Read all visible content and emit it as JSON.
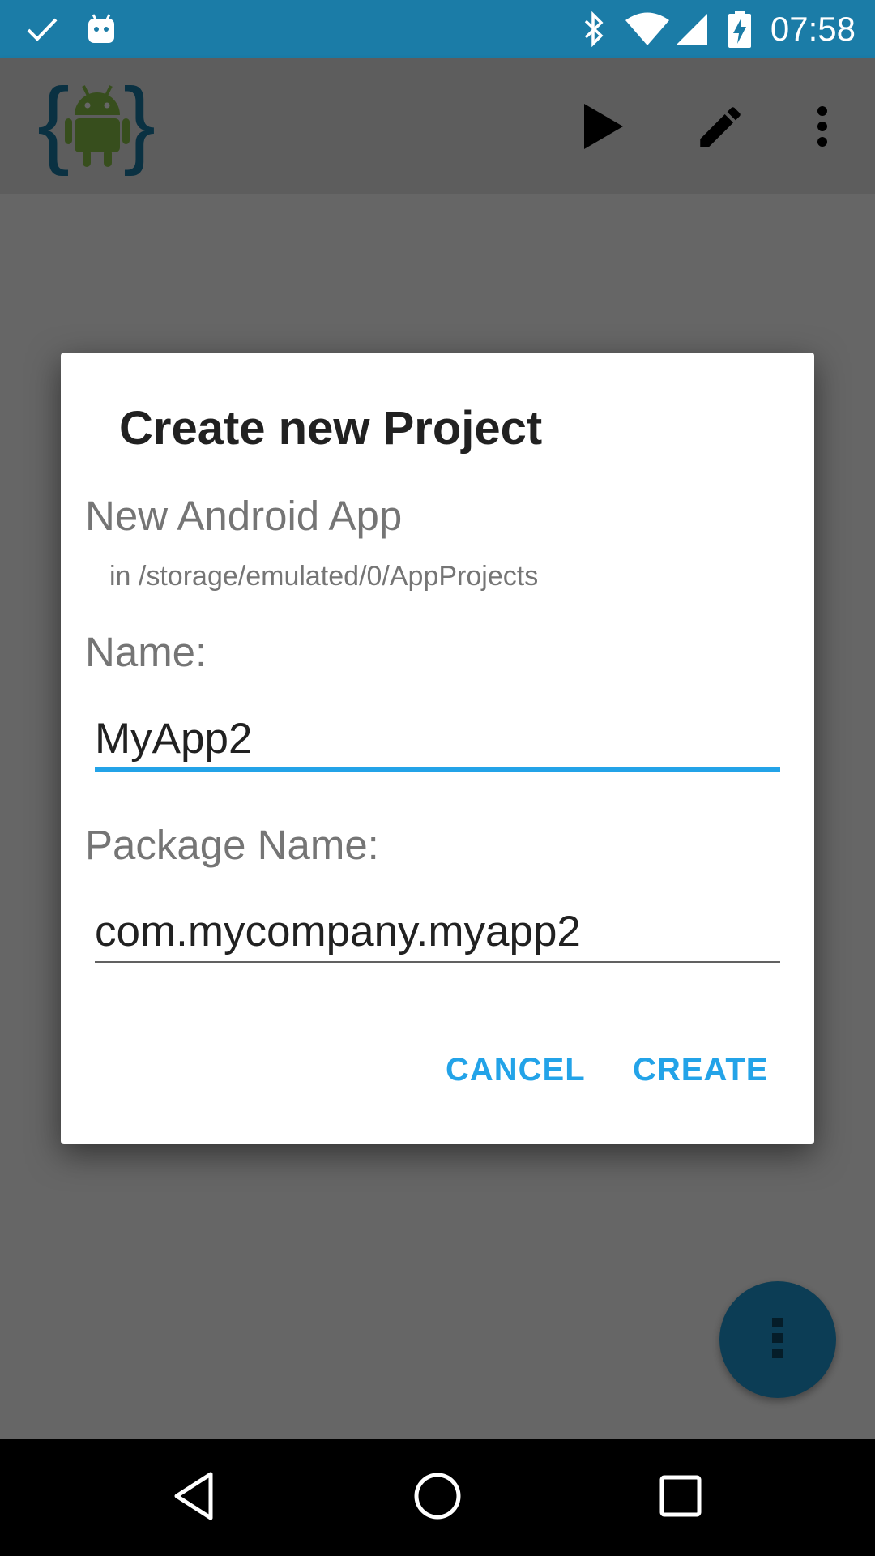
{
  "status_bar": {
    "time": "07:58",
    "icons": [
      "check-icon",
      "android-notification-icon",
      "bluetooth-icon",
      "wifi-icon",
      "cell-signal-icon",
      "battery-charging-icon"
    ],
    "color": "#1b7ca7"
  },
  "app_bar": {
    "logo": "android-ide-logo-icon",
    "actions": [
      "play-icon",
      "pencil-icon",
      "more-vert-icon"
    ]
  },
  "dialog": {
    "title": "Create new Project",
    "subtitle": "New Android App",
    "path": "in /storage/emulated/0/AppProjects",
    "name_label": "Name:",
    "name_value": "MyApp2",
    "package_label": "Package Name:",
    "package_value": "com.mycompany.myapp2",
    "cancel_label": "CANCEL",
    "create_label": "CREATE",
    "accent_color": "#23a3e8"
  },
  "fab": {
    "icon": "more-vert-icon"
  },
  "nav_bar": {
    "icons": [
      "back-icon",
      "home-icon",
      "recents-icon"
    ]
  }
}
